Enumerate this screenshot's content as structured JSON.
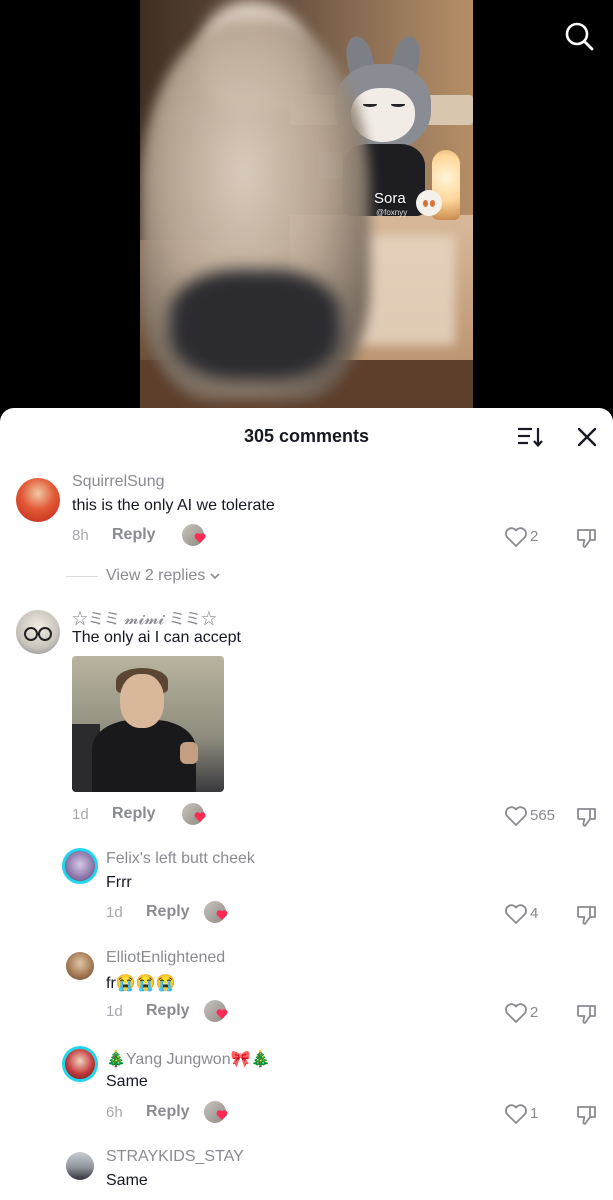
{
  "video": {
    "watermark_name": "Sora",
    "watermark_handle": "@foxnyy"
  },
  "comments_sheet": {
    "title": "305 comments",
    "view_replies_label": "View 2 replies"
  },
  "comments": [
    {
      "username": "SquirrelSung",
      "text": "this is the only AI we tolerate",
      "time": "8h",
      "reply_label": "Reply",
      "likes": "2"
    },
    {
      "username": "☆ミミ 𝓶𝓲𝓶𝓲 ミミ☆",
      "text": "The only ai I can accept",
      "time": "1d",
      "reply_label": "Reply",
      "likes": "565"
    },
    {
      "username": "Felix's left butt cheek",
      "text": "Frrr",
      "time": "1d",
      "reply_label": "Reply",
      "likes": "4"
    },
    {
      "username": "ElliotEnlightened",
      "text": "fr😭😭😭",
      "time": "1d",
      "reply_label": "Reply",
      "likes": "2"
    },
    {
      "username": "🎄Yang Jungwon🎀🎄",
      "text": "Same",
      "time": "6h",
      "reply_label": "Reply",
      "likes": "1"
    },
    {
      "username": "STRAYKIDS_STAY",
      "text": "Same"
    }
  ],
  "colors": {
    "text_primary": "#161823",
    "text_secondary": "#8a8b91",
    "heart_accent": "#fe2c55",
    "story_ring": "#20d5ec"
  }
}
